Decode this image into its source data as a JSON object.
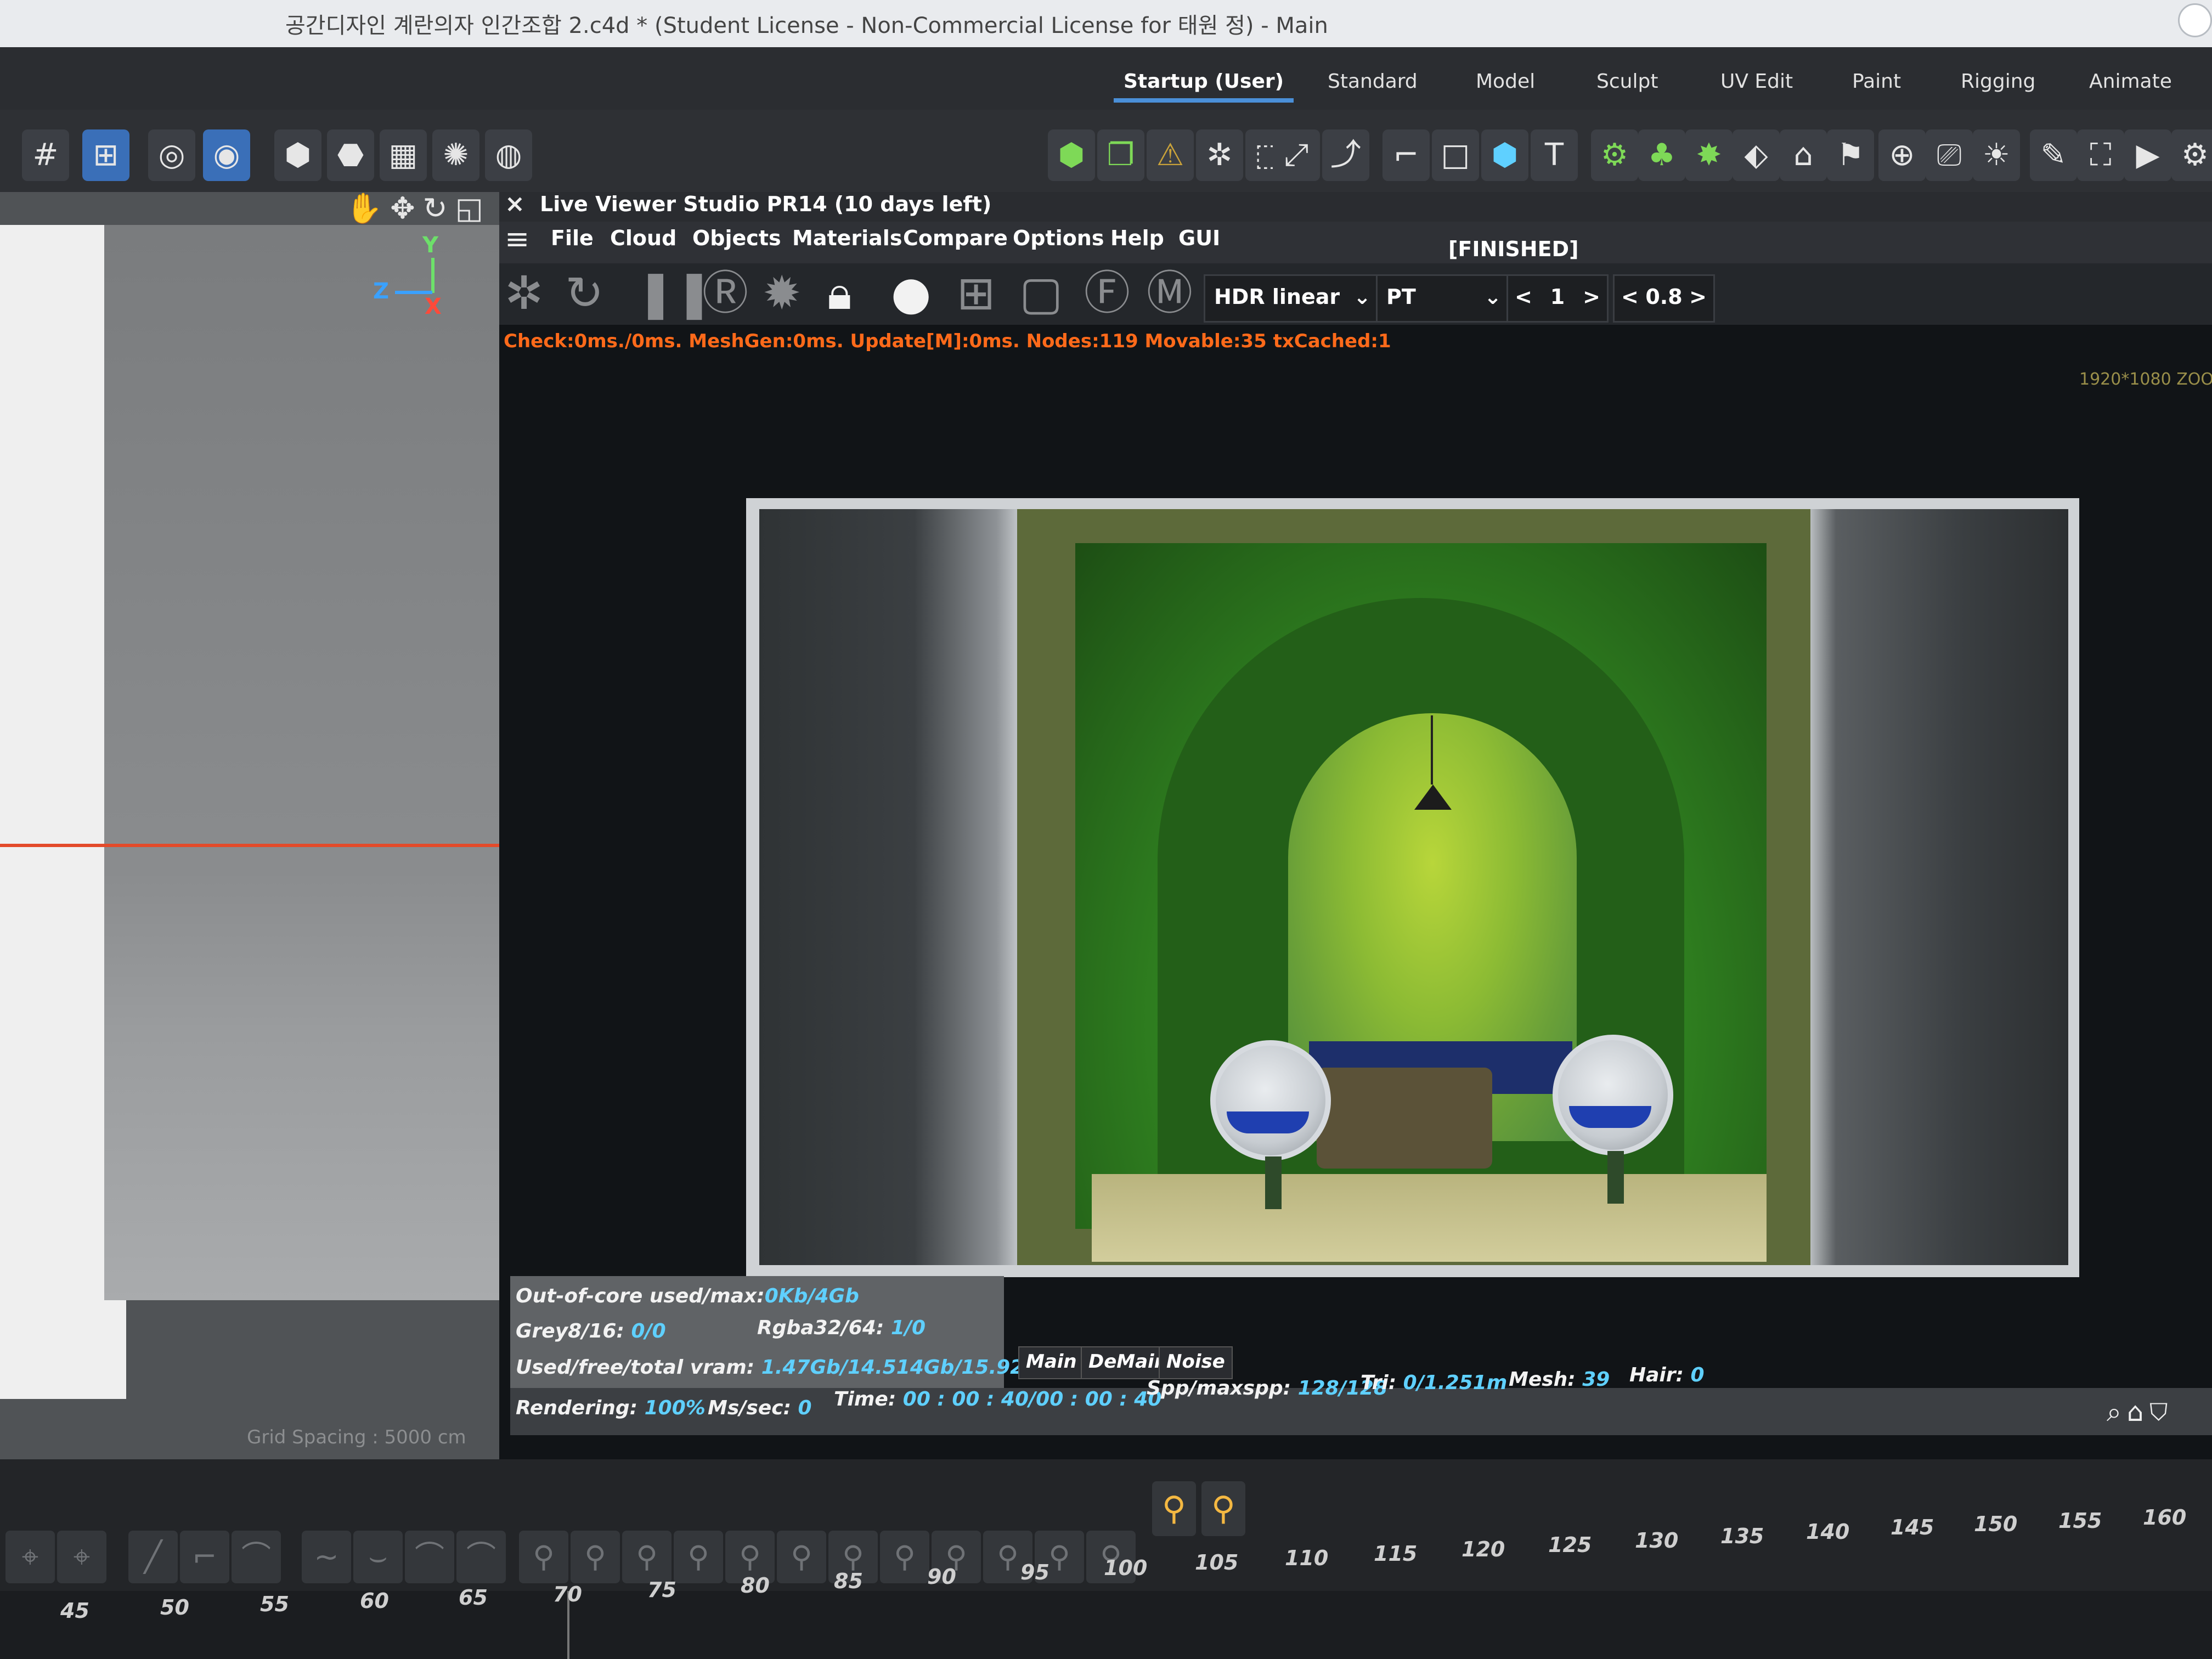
{
  "window": {
    "title": "공간디자인 계란의자 인간조합 2.c4d * (Student License - Non-Commercial License for 태원 정) - Main"
  },
  "layouts": [
    {
      "label": "Startup (User)",
      "active": true
    },
    {
      "label": "Standard",
      "active": false
    },
    {
      "label": "Model",
      "active": false
    },
    {
      "label": "Sculpt",
      "active": false
    },
    {
      "label": "UV Edit",
      "active": false
    },
    {
      "label": "Paint",
      "active": false
    },
    {
      "label": "Rigging",
      "active": false
    },
    {
      "label": "Animate",
      "active": false
    }
  ],
  "viewport": {
    "axis": {
      "y": "Y",
      "z": "Z",
      "x": "X"
    },
    "grid_spacing": "Grid Spacing : 5000 cm"
  },
  "live_viewer": {
    "title": "Live Viewer Studio PR14 (10 days left)",
    "close_glyph": "×",
    "menu": [
      "File",
      "Cloud",
      "Objects",
      "Materials",
      "Compare",
      "Options",
      "Help",
      "GUI"
    ],
    "status": "[FINISHED]",
    "tone_mapping": "HDR linear",
    "kernel": "PT",
    "stepper_1": {
      "prev": "<",
      "value": "1",
      "next": ">"
    },
    "stepper_2": {
      "prev": "<",
      "value": "0.8",
      "next": ">"
    },
    "perf_line": "Check:0ms./0ms. MeshGen:0ms. Update[M]:0ms. Nodes:119 Movable:35 txCached:1",
    "resolution": "1920*1080 ZOO"
  },
  "stats": {
    "out_of_core": {
      "label": "Out-of-core used/max:",
      "value": "0Kb/4Gb"
    },
    "grey": {
      "label": "Grey8/16:",
      "value": "0/0"
    },
    "rgba": {
      "label": "Rgba32/64:",
      "value": "1/0"
    },
    "vram": {
      "label": "Used/free/total vram:",
      "value": "1.47Gb/14.514Gb/15.924Gb"
    },
    "rendering": {
      "label": "Rendering:",
      "value": "100%"
    },
    "msec": {
      "label": "Ms/sec:",
      "value": "0"
    },
    "time": {
      "label": "Time:",
      "value": "00 : 00 : 40/00 : 00 : 40"
    },
    "spp": {
      "label": "Spp/maxspp:",
      "value": "128/128"
    },
    "tri": {
      "label": "Tri:",
      "value": "0/1.251m"
    },
    "mesh": {
      "label": "Mesh:",
      "value": "39"
    },
    "hair": {
      "label": "Hair:",
      "value": "0"
    }
  },
  "channel_tabs": [
    "Main",
    "DeMain",
    "Noise"
  ],
  "timeline": {
    "ticks_lower": [
      "45",
      "50",
      "55",
      "60",
      "65",
      "70",
      "75",
      "80",
      "85",
      "90",
      "95",
      "100"
    ],
    "ticks_upper": [
      "105",
      "110",
      "115",
      "120",
      "125",
      "130",
      "135",
      "140",
      "145",
      "150",
      "155",
      "160"
    ]
  },
  "icons": {
    "accent": "#4a8fd8",
    "orange": "#ff6a1a",
    "cyan": "#5fd0ff"
  }
}
